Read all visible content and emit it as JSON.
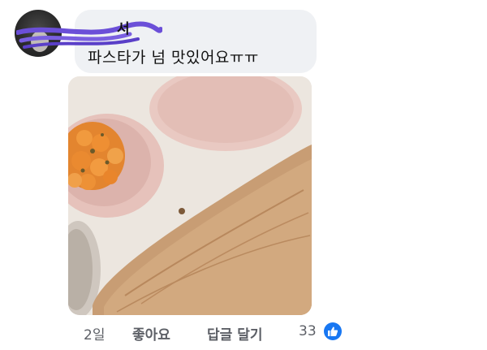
{
  "comment": {
    "author": "서",
    "text": "파스타가 넘 맛있어요ㅠㅠ"
  },
  "actions": {
    "time": "2일",
    "like": "좋아요",
    "reply": "답글 달기",
    "reaction_count": "33"
  },
  "colors": {
    "bubble": "#eff1f4",
    "meta_text": "#5c5f66",
    "like_blue": "#1877f2",
    "redaction": "#6b4fd8"
  },
  "icons": {
    "reaction": "thumbs-up-icon"
  }
}
